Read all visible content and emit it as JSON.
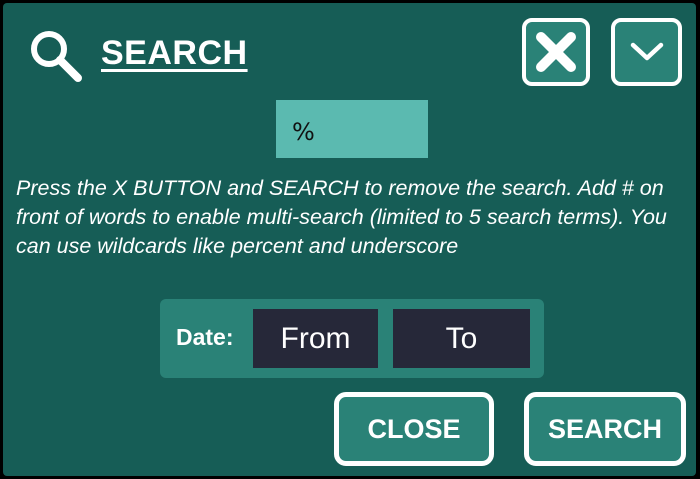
{
  "header": {
    "title": "SEARCH",
    "icons": [
      "search-icon",
      "close-icon",
      "chevron-down-icon"
    ]
  },
  "search": {
    "value": "%",
    "placeholder": ""
  },
  "help_text": "Press the X BUTTON and SEARCH to remove the search. Add # on front of words to enable multi-search (limited to 5 search terms). You can use wildcards like percent and underscore",
  "date": {
    "label": "Date:",
    "from_label": "From",
    "to_label": "To"
  },
  "buttons": {
    "close_label": "CLOSE",
    "search_label": "SEARCH"
  },
  "colors": {
    "panel": "#165d56",
    "button": "#2a8277",
    "input": "#5bbab0",
    "date_field": "#262839",
    "text": "#ffffff"
  }
}
